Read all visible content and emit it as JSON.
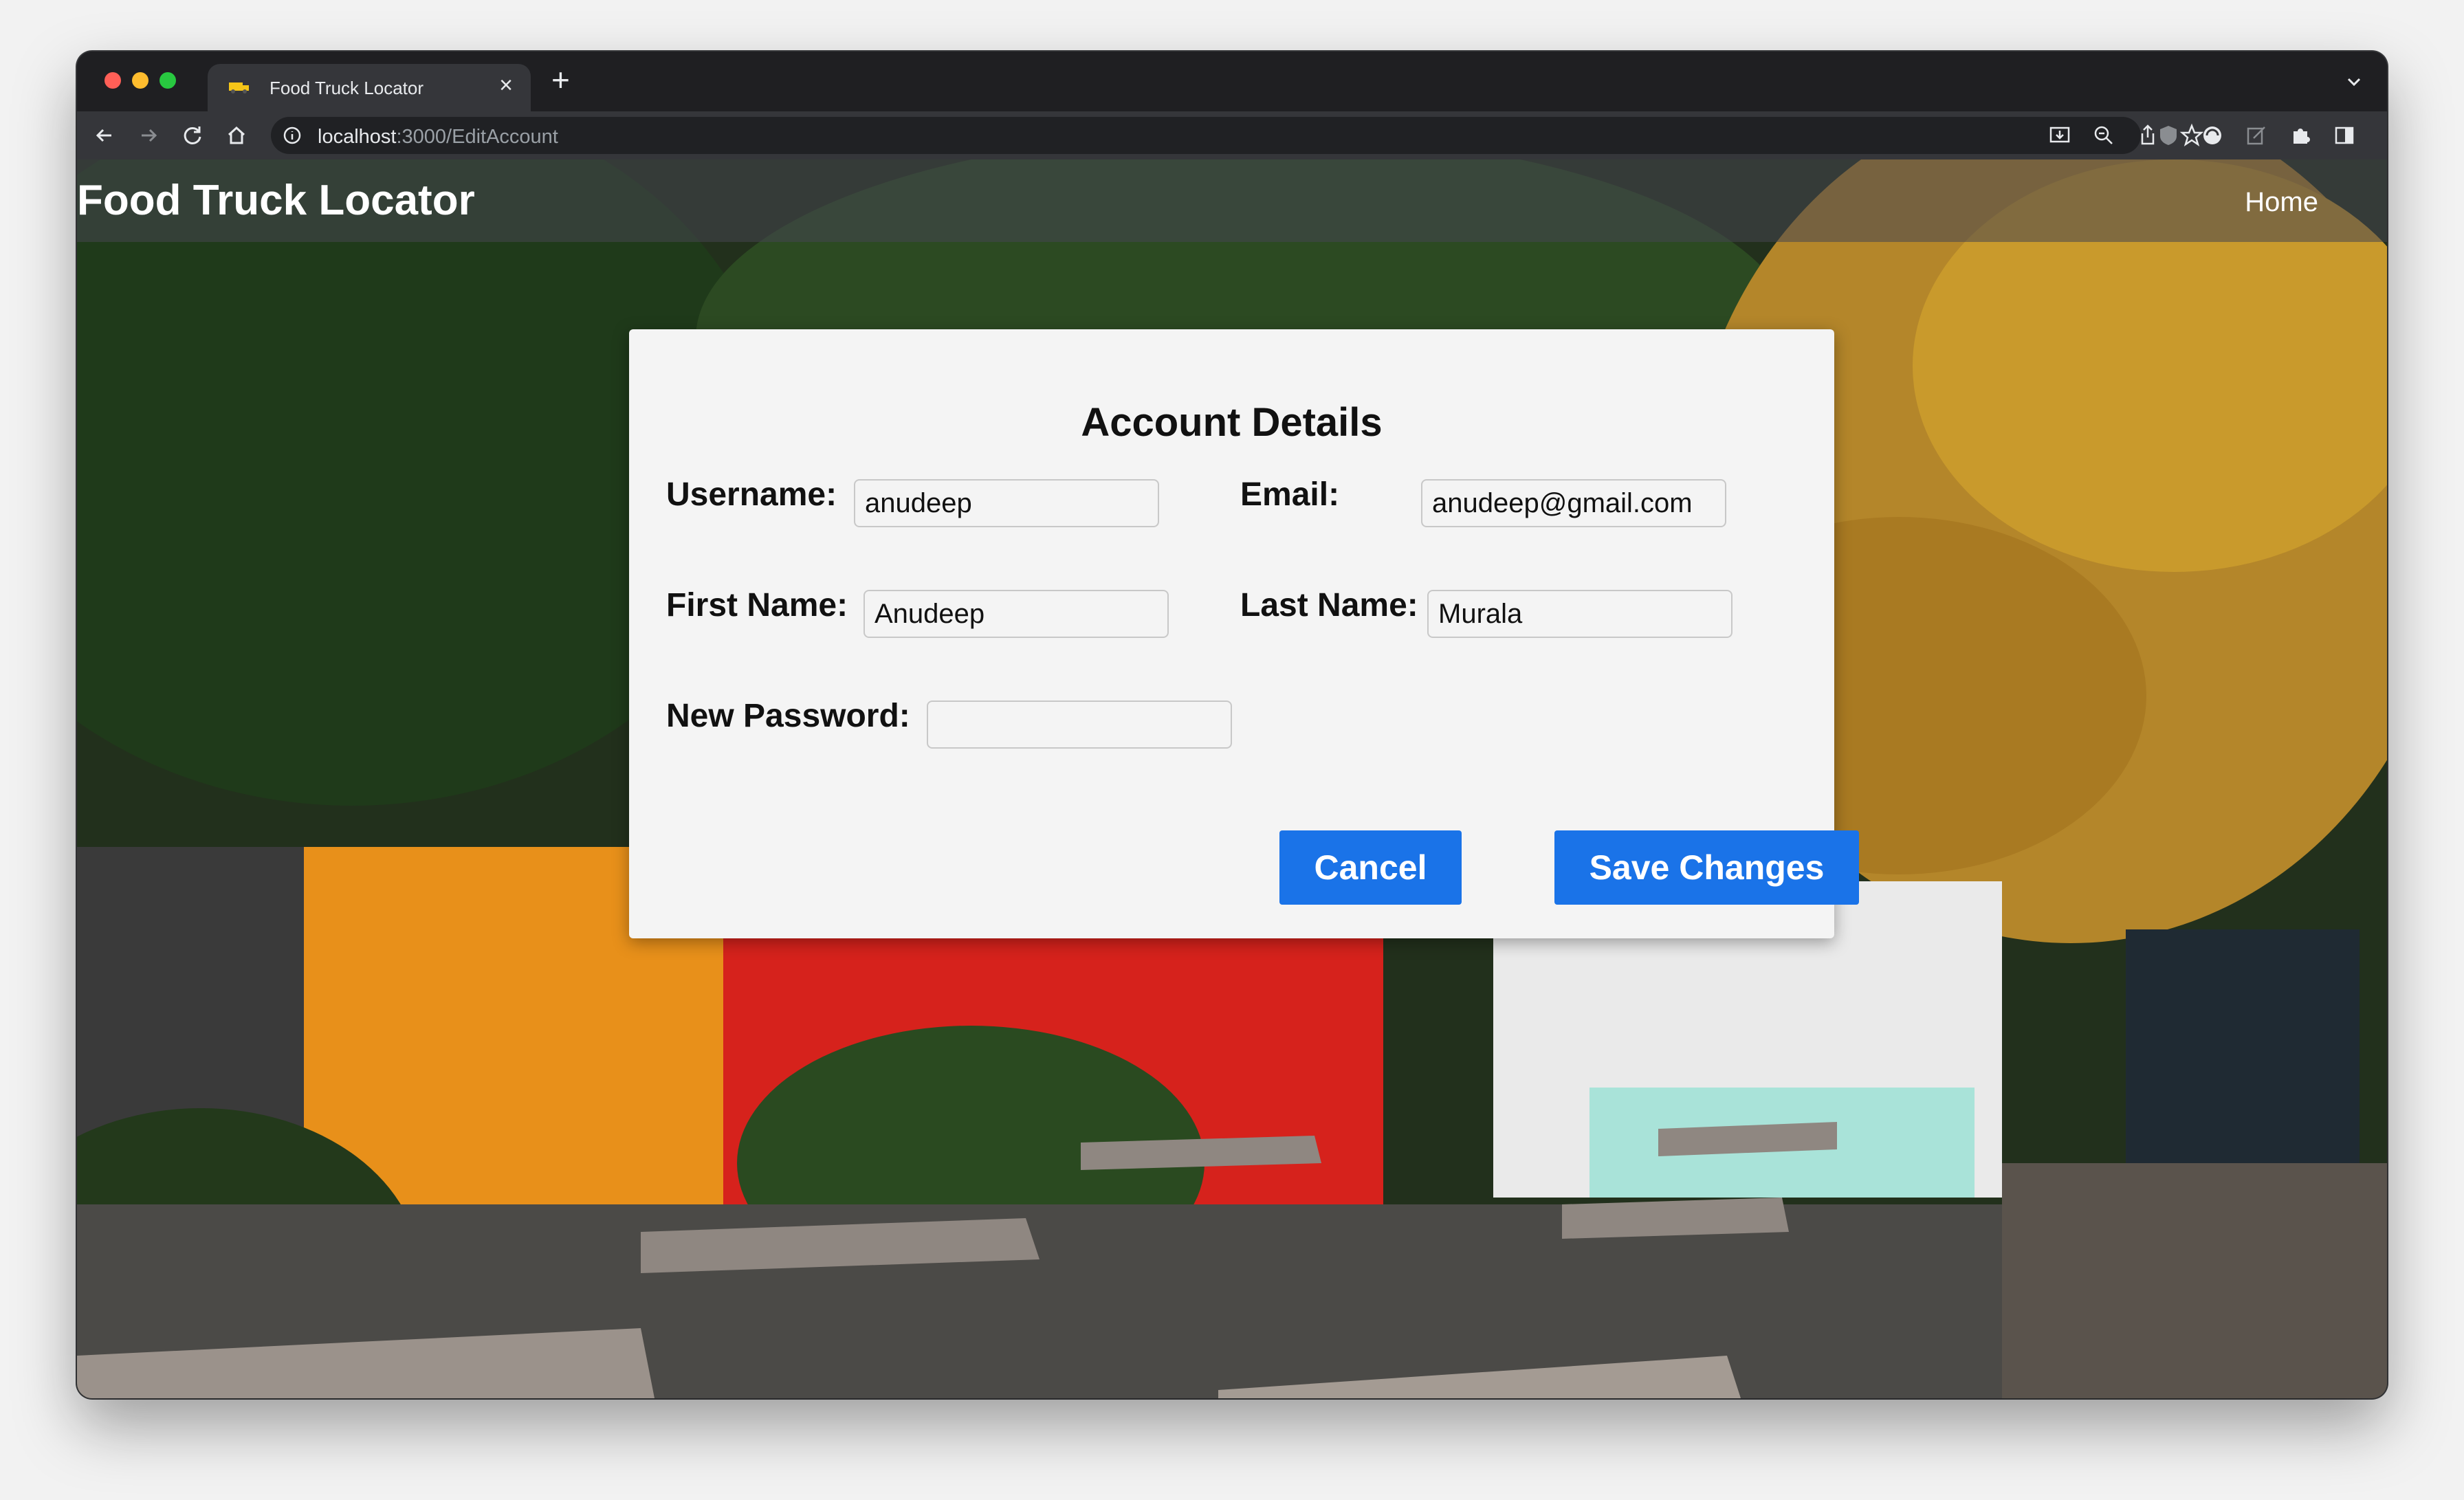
{
  "browser": {
    "tab_title": "Food Truck Locator",
    "tab_close": "×",
    "new_tab": "+",
    "url_host": "localhost",
    "url_path": ":3000/EditAccount"
  },
  "navbar": {
    "brand": "Food Truck Locator",
    "home": "Home"
  },
  "modal": {
    "title": "Account Details",
    "fields": {
      "username": {
        "label": "Username:",
        "value": "anudeep"
      },
      "email": {
        "label": "Email:",
        "value": "anudeep@gmail.com"
      },
      "first_name": {
        "label": "First Name:",
        "value": "Anudeep"
      },
      "last_name": {
        "label": "Last Name:",
        "value": "Murala"
      },
      "new_password": {
        "label": "New Password:",
        "value": ""
      }
    },
    "cancel": "Cancel",
    "save": "Save Changes"
  },
  "colors": {
    "accent": "#1a73e8",
    "modal_bg": "#f4f4f4"
  }
}
